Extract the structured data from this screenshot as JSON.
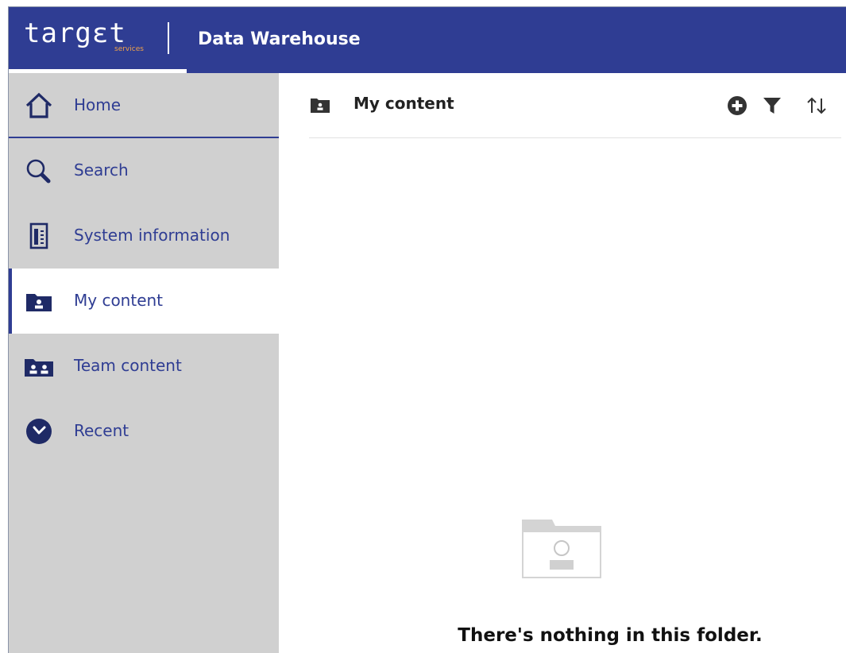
{
  "header": {
    "logo_text": "targεt",
    "logo_subtext": "services",
    "app_title": "Data Warehouse"
  },
  "sidebar": {
    "items": [
      {
        "label": "Home",
        "icon": "home-icon",
        "active": false
      },
      {
        "label": "Search",
        "icon": "search-icon",
        "active": false
      },
      {
        "label": "System information",
        "icon": "system-information-icon",
        "active": false
      },
      {
        "label": "My content",
        "icon": "my-content-folder-icon",
        "active": true
      },
      {
        "label": "Team content",
        "icon": "team-content-folder-icon",
        "active": false
      },
      {
        "label": "Recent",
        "icon": "recent-icon",
        "active": false
      }
    ]
  },
  "main": {
    "title": "My content",
    "actions": [
      {
        "name": "add",
        "icon": "add-circle-icon"
      },
      {
        "name": "filter",
        "icon": "filter-icon"
      },
      {
        "name": "sort",
        "icon": "sort-icon"
      }
    ],
    "empty_message": "There's nothing in this folder."
  },
  "colors": {
    "brand": "#2f3d93",
    "sidebar_bg": "#d0d0d0",
    "accent_orange": "#f0a24a"
  }
}
